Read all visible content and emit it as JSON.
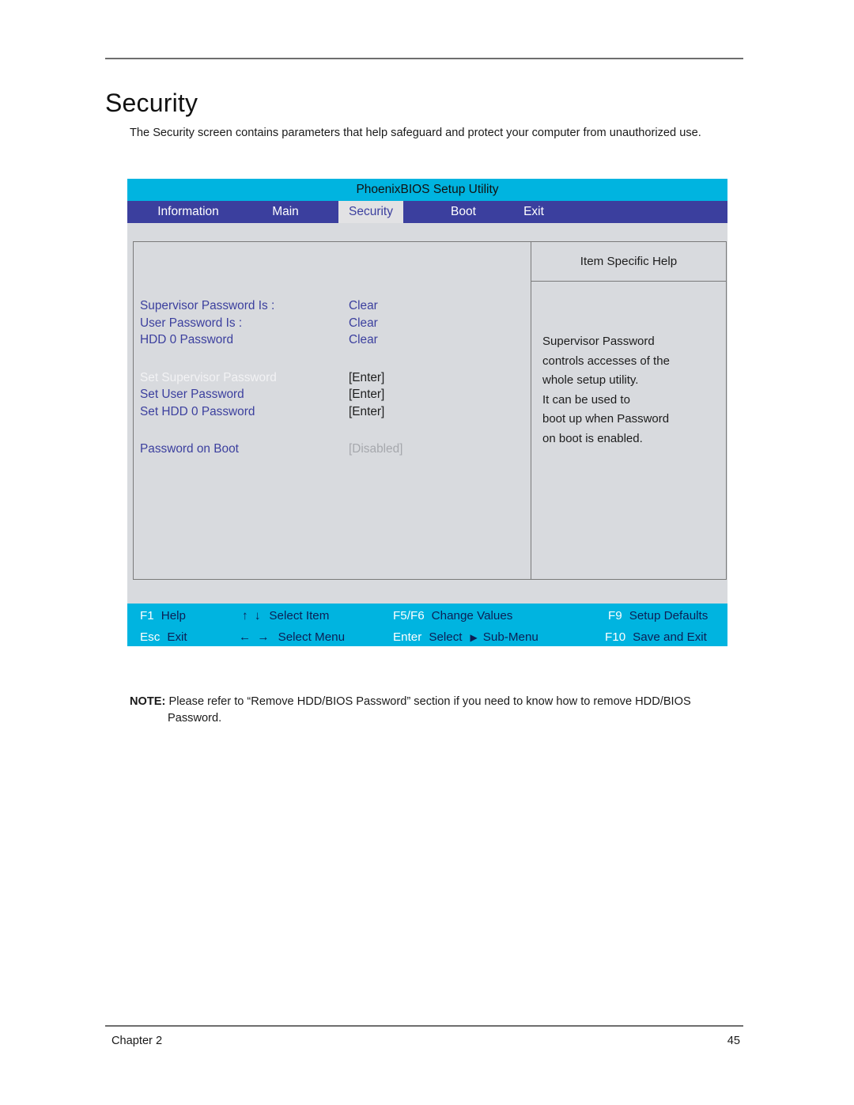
{
  "page": {
    "title": "Security",
    "intro": "The Security screen contains parameters that help safeguard and protect your computer from unauthorized use.",
    "note_label": "NOTE:",
    "note_text": "Please refer to “Remove HDD/BIOS Password” section if you need to know how to remove HDD/BIOS",
    "note_text_cont": "Password.",
    "chapter": "Chapter 2",
    "page_number": "45"
  },
  "bios": {
    "utility_title": "PhoenixBIOS Setup Utility",
    "colors": {
      "title_bar": "#00b4e0",
      "menu_bar": "#3b3f9e",
      "screen_bg": "#d8dade",
      "label_blue": "#3b3f9e",
      "footer_bar": "#00b4e0",
      "footer_desc": "#0c1f55",
      "muted": "#a6a8ad"
    },
    "tabs": [
      {
        "label": "Information",
        "active": false
      },
      {
        "label": "Main",
        "active": false
      },
      {
        "label": "Security",
        "active": true
      },
      {
        "label": "Boot",
        "active": false
      },
      {
        "label": "Exit",
        "active": false
      }
    ],
    "settings": [
      {
        "label": "Supervisor Password Is :",
        "value": "Clear",
        "value_style": "blue",
        "selected": false
      },
      {
        "label": "User Password Is :",
        "value": "Clear",
        "value_style": "blue",
        "selected": false
      },
      {
        "label": "HDD 0 Password",
        "value": "Clear",
        "value_style": "blue",
        "selected": false
      },
      {
        "label": "Set Supervisor Password",
        "value": "[Enter]",
        "value_style": "dark",
        "selected": true
      },
      {
        "label": "Set User Password",
        "value": "[Enter]",
        "value_style": "dark",
        "selected": false
      },
      {
        "label": "Set HDD 0 Password",
        "value": "[Enter]",
        "value_style": "dark",
        "selected": false
      },
      {
        "label": "Password on Boot",
        "value": "[Disabled]",
        "value_style": "muted",
        "selected": false
      }
    ],
    "help": {
      "title": "Item Specific Help",
      "lines": [
        "Supervisor Password",
        "controls accesses of the",
        "whole setup utility.",
        "It can be used to",
        "boot up when Password",
        "on boot is enabled."
      ]
    },
    "footer_keys": [
      {
        "key": "F1",
        "desc": "Help"
      },
      {
        "key": "↑ ↓",
        "desc": "Select Item",
        "key_is_arrows": true
      },
      {
        "key": "F5/F6",
        "desc": "Change Values"
      },
      {
        "key": "F9",
        "desc": "Setup Defaults"
      },
      {
        "key": "Esc",
        "desc": "Exit"
      },
      {
        "key": "← →",
        "desc": "Select Menu",
        "key_is_arrows": true
      },
      {
        "key": "Enter",
        "desc": "Select",
        "desc2": "Sub-Menu",
        "has_triangle": true
      },
      {
        "key": "F10",
        "desc": "Save and Exit"
      }
    ]
  }
}
